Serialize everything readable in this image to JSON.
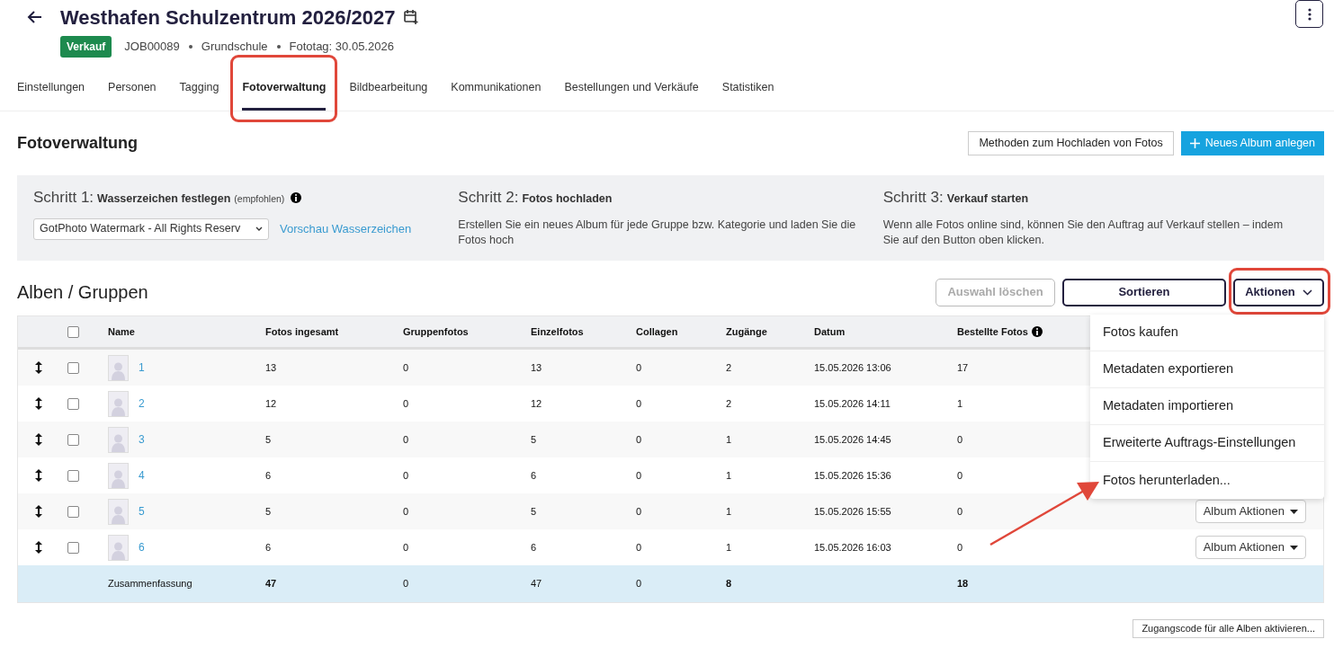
{
  "header": {
    "title": "Westhafen Schulzentrum 2026/2027",
    "status_badge": "Verkauf",
    "job_id": "JOB00089",
    "school_type": "Grundschule",
    "photo_day": "Fototag: 30.05.2026"
  },
  "tabs": [
    {
      "label": "Einstellungen",
      "selected": false
    },
    {
      "label": "Personen",
      "selected": false
    },
    {
      "label": "Tagging",
      "selected": false
    },
    {
      "label": "Fotoverwaltung",
      "selected": true
    },
    {
      "label": "Bildbearbeitung",
      "selected": false
    },
    {
      "label": "Kommunikationen",
      "selected": false
    },
    {
      "label": "Bestellungen und Verkäufe",
      "selected": false
    },
    {
      "label": "Statistiken",
      "selected": false
    }
  ],
  "section": {
    "title": "Fotoverwaltung",
    "buttons": [
      "Methoden zum Hochladen von Fotos",
      "Neues Album anlegen"
    ]
  },
  "steps": [
    {
      "step": "Schritt 1:",
      "title": "Wasserzeichen festlegen",
      "note": "(empfohlen)",
      "select_value": "GotPhoto Watermark - All Rights Reserv",
      "link": "Vorschau Wasserzeichen"
    },
    {
      "step": "Schritt 2:",
      "title": "Fotos hochladen",
      "text": "Erstellen Sie ein neues Album für jede Gruppe bzw. Kategorie und laden Sie die Fotos hoch"
    },
    {
      "step": "Schritt 3:",
      "title": "Verkauf starten",
      "text": "Wenn alle Fotos online sind, können Sie den Auftrag auf Verkauf stellen – indem Sie auf den Button oben klicken."
    }
  ],
  "albums": {
    "title": "Alben / Gruppen",
    "buttons": [
      {
        "label": "Auswahl löschen",
        "disabled": true
      },
      {
        "label": "Sortieren",
        "disabled": false
      },
      {
        "label": "Aktionen",
        "disabled": false
      }
    ],
    "select_all_checked": false,
    "columns": [
      "Name",
      "Fotos ingesamt",
      "Gruppenfotos",
      "Einzelfotos",
      "Collagen",
      "Zugänge",
      "Datum",
      "Bestellte Fotos"
    ],
    "rows": [
      {
        "checked": false,
        "cells": [
          "1",
          "13",
          "0",
          "13",
          "0",
          "2",
          "15.05.2026 13:06",
          "17"
        ]
      },
      {
        "checked": false,
        "cells": [
          "2",
          "12",
          "0",
          "12",
          "0",
          "2",
          "15.05.2026 14:11",
          "1"
        ]
      },
      {
        "checked": false,
        "cells": [
          "3",
          "5",
          "0",
          "5",
          "0",
          "1",
          "15.05.2026 14:45",
          "0"
        ]
      },
      {
        "checked": false,
        "cells": [
          "4",
          "6",
          "0",
          "6",
          "0",
          "1",
          "15.05.2026 15:36",
          "0"
        ]
      },
      {
        "checked": false,
        "cells": [
          "5",
          "5",
          "0",
          "5",
          "0",
          "1",
          "15.05.2026 15:55",
          "0"
        ],
        "action": "Album Aktionen"
      },
      {
        "checked": false,
        "cells": [
          "6",
          "6",
          "0",
          "6",
          "0",
          "1",
          "15.05.2026 16:03",
          "0"
        ],
        "action": "Album Aktionen"
      }
    ],
    "summary": {
      "cells": [
        {
          "text": "Zusammenfassung",
          "bold": false
        },
        {
          "text": "47",
          "bold": true
        },
        {
          "text": "0",
          "bold": false
        },
        {
          "text": "47",
          "bold": false
        },
        {
          "text": "0",
          "bold": false
        },
        {
          "text": "8",
          "bold": true
        },
        null,
        {
          "text": "18",
          "bold": true
        }
      ]
    },
    "actions_menu": [
      "Fotos kaufen",
      "Metadaten exportieren",
      "Metadaten importieren",
      "Erweiterte Auftrags-Einstellungen",
      "Fotos herunterladen..."
    ],
    "footer_button": "Zugangscode für alle Alben aktivieren..."
  }
}
